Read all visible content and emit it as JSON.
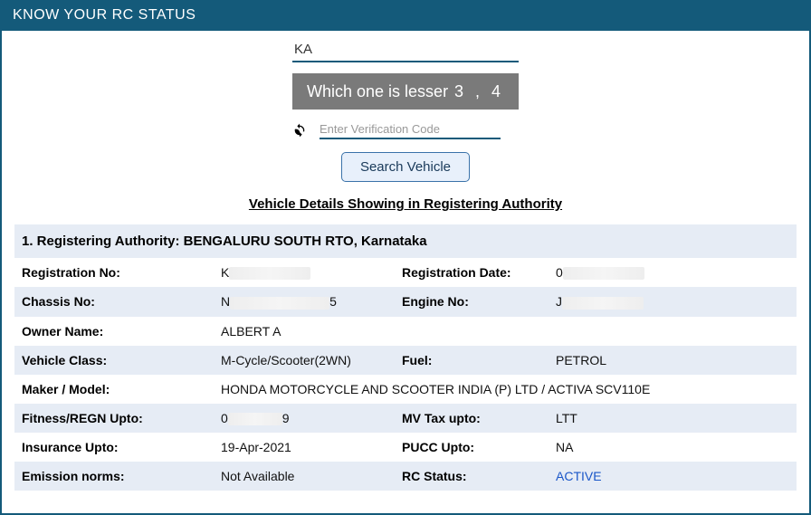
{
  "header": {
    "title": "KNOW YOUR RC STATUS"
  },
  "form": {
    "reg_prefix": "KA",
    "captcha_text": "Which one is lesser",
    "captcha_nums": "3  ,  4",
    "verify_placeholder": "Enter Verification Code",
    "search_label": "Search Vehicle"
  },
  "section_title": "Vehicle Details Showing in Registering Authority",
  "authority": {
    "label": "1. Registering Authority:",
    "value": "BENGALURU SOUTH RTO, Karnataka"
  },
  "details": {
    "reg_no_label": "Registration No:",
    "reg_no": "K",
    "reg_date_label": "Registration Date:",
    "reg_date": "0",
    "chassis_label": "Chassis No:",
    "chassis_prefix": "N",
    "chassis_suffix": "5",
    "engine_label": "Engine No:",
    "engine": "J",
    "owner_label": "Owner Name:",
    "owner": "ALBERT A",
    "class_label": "Vehicle Class:",
    "class": "M-Cycle/Scooter(2WN)",
    "fuel_label": "Fuel:",
    "fuel": "PETROL",
    "maker_label": "Maker / Model:",
    "maker": "HONDA MOTORCYCLE AND SCOOTER INDIA (P) LTD / ACTIVA SCV110E",
    "fitness_label": "Fitness/REGN Upto:",
    "fitness_prefix": "0",
    "fitness_suffix": "9",
    "mvtax_label": "MV Tax upto:",
    "mvtax": "LTT",
    "insurance_label": "Insurance Upto:",
    "insurance": "19-Apr-2021",
    "pucc_label": "PUCC Upto:",
    "pucc": "NA",
    "emission_label": "Emission norms:",
    "emission": "Not Available",
    "rc_status_label": "RC Status:",
    "rc_status": "ACTIVE"
  }
}
